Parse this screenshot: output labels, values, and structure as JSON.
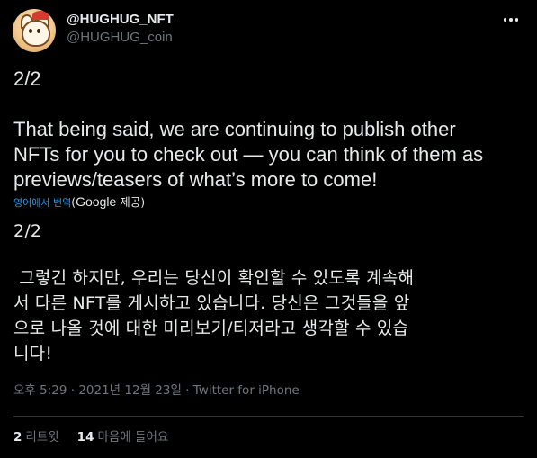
{
  "author": {
    "display_name": "@HUGHUG_NFT",
    "handle": "@HUGHUG_coin"
  },
  "tweet": {
    "paragraph_1": "2/2",
    "paragraph_2": "That being said, we are continuing to publish other\nNFTs for you to check out — you can think of them as\npreviews/teasers of what’s more to come!"
  },
  "translation": {
    "link_label": "영어에서 번역",
    "provider_prefix": "(",
    "provider": "Google",
    "provider_suffix": " 제공)",
    "paragraph_1": "2/2",
    "paragraph_2": " 그렇긴 하지만, 우리는 당신이 확인할 수 있도록 계속해\n서 다른 NFT를 게시하고 있습니다. 당신은 그것들을 앞\n으로 나올 것에 대한 미리보기/티저라고 생각할 수 있습\n니다!"
  },
  "meta": {
    "timestamp": "오후 5:29 · 2021년 12월 23일",
    "separator": " · ",
    "source": "Twitter for iPhone"
  },
  "stats": {
    "retweets_count": "2",
    "retweets_label": "리트윗",
    "likes_count": "14",
    "likes_label": "마음에 들어요"
  },
  "colors": {
    "background": "#000000",
    "text": "#e7e9ea",
    "secondary_text": "#71767b",
    "link": "#1d9bf0",
    "divider": "#2f3336"
  },
  "icons": {
    "more": "more-horizontal-icon",
    "avatar": "cat-avatar"
  }
}
